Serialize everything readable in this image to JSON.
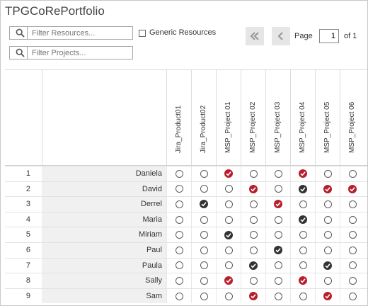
{
  "app": {
    "title": "TPGCoRePortfolio"
  },
  "filters": {
    "resources_placeholder": "Filter Resources...",
    "projects_placeholder": "Filter Projects...",
    "generic_resources_label": "Generic Resources"
  },
  "pagination": {
    "page_label": "Page",
    "page_value": "1",
    "of_label": "of 1",
    "first_icon": "first-page-icon",
    "prev_icon": "previous-page-icon"
  },
  "colors": {
    "selected_red": "#b81e2b",
    "selected_dark": "#333333",
    "name_cell_bg": "#f0f0f0"
  },
  "columns": [
    "Jira_Product01",
    "Jira_Product02",
    "MSP_Project 01",
    "MSP_Project 02",
    "MSP_Project 03",
    "MSP_Project 04",
    "MSP_Project 05",
    "MSP_Project 06"
  ],
  "rows": [
    {
      "num": "1",
      "name": "Daniela",
      "cells": [
        "empty",
        "empty",
        "red",
        "empty",
        "empty",
        "red",
        "empty",
        "empty"
      ]
    },
    {
      "num": "2",
      "name": "David",
      "cells": [
        "empty",
        "empty",
        "empty",
        "red",
        "empty",
        "dark",
        "red",
        "red"
      ]
    },
    {
      "num": "3",
      "name": "Derrel",
      "cells": [
        "empty",
        "dark",
        "empty",
        "empty",
        "red",
        "empty",
        "empty",
        "empty"
      ]
    },
    {
      "num": "4",
      "name": "Maria",
      "cells": [
        "empty",
        "empty",
        "empty",
        "empty",
        "empty",
        "dark",
        "empty",
        "empty"
      ]
    },
    {
      "num": "5",
      "name": "Miriam",
      "cells": [
        "empty",
        "empty",
        "dark",
        "empty",
        "empty",
        "empty",
        "empty",
        "empty"
      ]
    },
    {
      "num": "6",
      "name": "Paul",
      "cells": [
        "empty",
        "empty",
        "empty",
        "empty",
        "dark",
        "empty",
        "empty",
        "empty"
      ]
    },
    {
      "num": "7",
      "name": "Paula",
      "cells": [
        "empty",
        "empty",
        "empty",
        "dark",
        "empty",
        "empty",
        "dark",
        "empty"
      ]
    },
    {
      "num": "8",
      "name": "Sally",
      "cells": [
        "empty",
        "empty",
        "red",
        "empty",
        "empty",
        "red",
        "empty",
        "empty"
      ]
    },
    {
      "num": "9",
      "name": "Sam",
      "cells": [
        "empty",
        "empty",
        "empty",
        "red",
        "empty",
        "empty",
        "red",
        "empty"
      ]
    }
  ]
}
